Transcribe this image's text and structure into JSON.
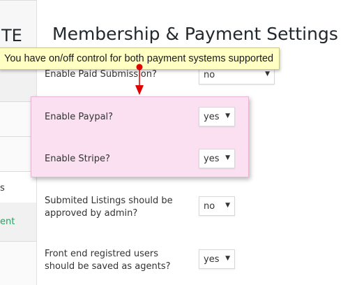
{
  "sidebar": {
    "title_fragment": "TE",
    "item_fragment": "s",
    "link_fragment": "ent"
  },
  "page": {
    "title": "Membership & Payment Settings"
  },
  "tooltip": {
    "text": "You have on/off control for both payment systems supported"
  },
  "settings": [
    {
      "label": "Enable Paid Submission?",
      "value": "no"
    },
    {
      "label": "Enable Paypal?",
      "value": "yes"
    },
    {
      "label": "Enable Stripe?",
      "value": "yes"
    },
    {
      "label": "Submited Listings should be approved by admin?",
      "value": "no"
    },
    {
      "label": "Front end registred users should be saved as agents?",
      "value": "yes"
    }
  ],
  "colors": {
    "highlight": "#fbe0f2",
    "tooltip": "#ffffc4",
    "arrow": "#e00000",
    "link": "#2a9d63"
  }
}
